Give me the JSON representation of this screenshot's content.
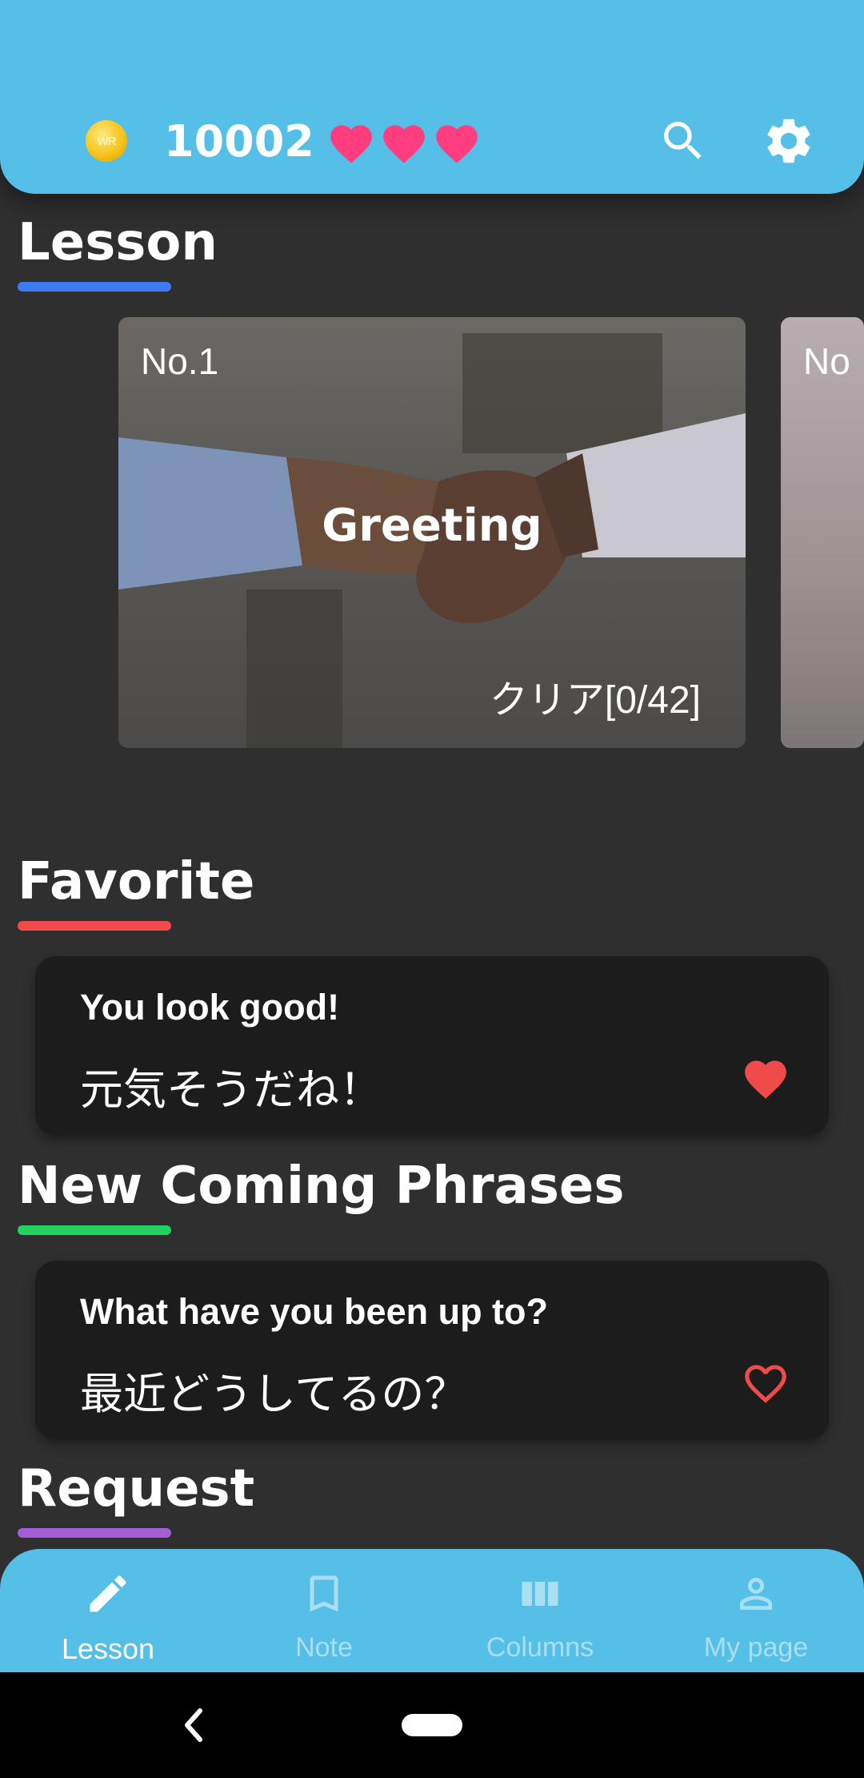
{
  "header": {
    "coin_label": "WR",
    "coin_count": "10002",
    "lives": 3,
    "colors": {
      "bar": "#55bfe8",
      "heart": "#ff3d7f"
    },
    "icons": [
      "coin-icon",
      "heart-icon",
      "search-icon",
      "gear-icon"
    ]
  },
  "sections": {
    "lesson": {
      "title": "Lesson",
      "accent": "#3d7bf5"
    },
    "favorite": {
      "title": "Favorite",
      "accent": "#f04a4a"
    },
    "new": {
      "title": "New Coming Phrases",
      "accent": "#22d160"
    },
    "request": {
      "title": "Request",
      "accent": "#a35fd6"
    }
  },
  "lessons": [
    {
      "number": "No.1",
      "title": "Greeting",
      "progress": "クリア[0/42]"
    },
    {
      "number": "No"
    }
  ],
  "favorite_phrase": {
    "english": "You look good!",
    "japanese": "元気そうだね！",
    "favorited": true
  },
  "new_phrase": {
    "english": "What have you been up to?",
    "japanese": "最近どうしてるの？",
    "favorited": false
  },
  "nav": {
    "items": [
      {
        "label": "Lesson",
        "icon": "pencil-icon",
        "active": true
      },
      {
        "label": "Note",
        "icon": "bookmark-icon",
        "active": false
      },
      {
        "label": "Columns",
        "icon": "columns-icon",
        "active": false
      },
      {
        "label": "My page",
        "icon": "person-icon",
        "active": false
      }
    ]
  }
}
